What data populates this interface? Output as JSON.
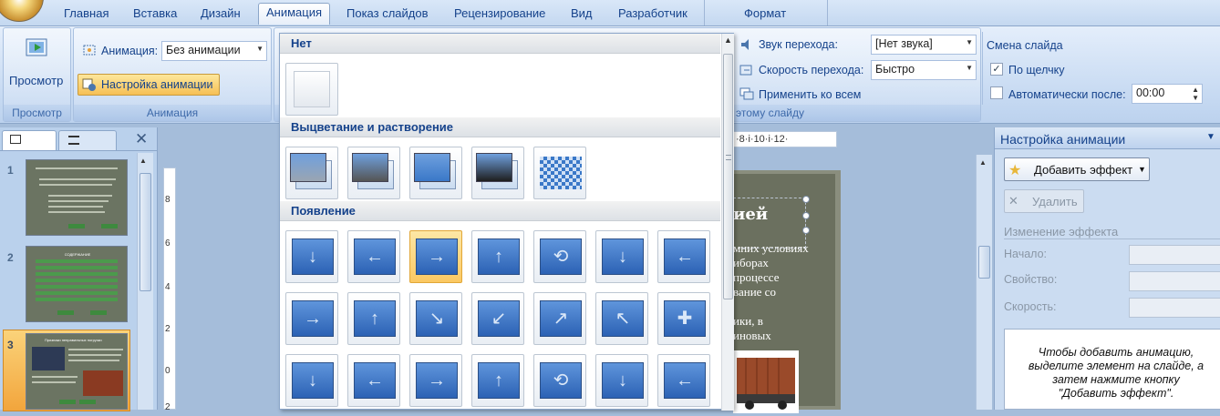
{
  "tabs": [
    "Главная",
    "Вставка",
    "Дизайн",
    "Анимация",
    "Показ слайдов",
    "Рецензирование",
    "Вид",
    "Разработчик",
    "Формат"
  ],
  "active_tab": "Анимация",
  "ribbon": {
    "preview_group": {
      "button": "Просмотр",
      "label": "Просмотр"
    },
    "animation_group": {
      "anim_label": "Анимация:",
      "anim_value": "Без анимации",
      "custom_btn": "Настройка анимации",
      "label": "Анимация"
    },
    "transition": {
      "sound_label": "Звук перехода:",
      "sound_value": "[Нет звука]",
      "speed_label": "Скорость перехода:",
      "speed_value": "Быстро",
      "apply_all": "Применить ко всем",
      "group_label_partial": "этому слайду"
    },
    "advance": {
      "title": "Смена слайда",
      "on_click": "По щелчку",
      "on_click_checked": true,
      "auto_after": "Автоматически после:",
      "auto_after_checked": false,
      "time": "00:00"
    }
  },
  "gallery": {
    "sections": [
      {
        "title": "Нет",
        "count": 1
      },
      {
        "title": "Выцветание и растворение",
        "count": 5
      },
      {
        "title": "Появление",
        "count": 21
      }
    ],
    "selected_index": 2
  },
  "slides": [
    {
      "num": "1"
    },
    {
      "num": "2",
      "title": "СОДЕРЖАНИЕ"
    },
    {
      "num": "3",
      "title": "Признаки неправильных погрузки"
    }
  ],
  "slide_partial": {
    "title_fragment": "ией",
    "lines": [
      "мних условиях",
      "иборах",
      "процессе",
      "вание со",
      "",
      "ики, в",
      "иновых"
    ]
  },
  "ruler": "·8·i·10·i·12·",
  "vertical_ruler": [
    "8",
    "6",
    "4",
    "2",
    "0",
    "2"
  ],
  "task_pane": {
    "title": "Настройка анимации",
    "add_effect": "Добавить эффект",
    "remove": "Удалить",
    "change_effect": "Изменение эффекта",
    "start": "Начало:",
    "property": "Свойство:",
    "speed": "Скорость:",
    "hint": "Чтобы добавить анимацию, выделите элемент на слайде, а затем нажмите кнопку \"Добавить эффект\"."
  }
}
